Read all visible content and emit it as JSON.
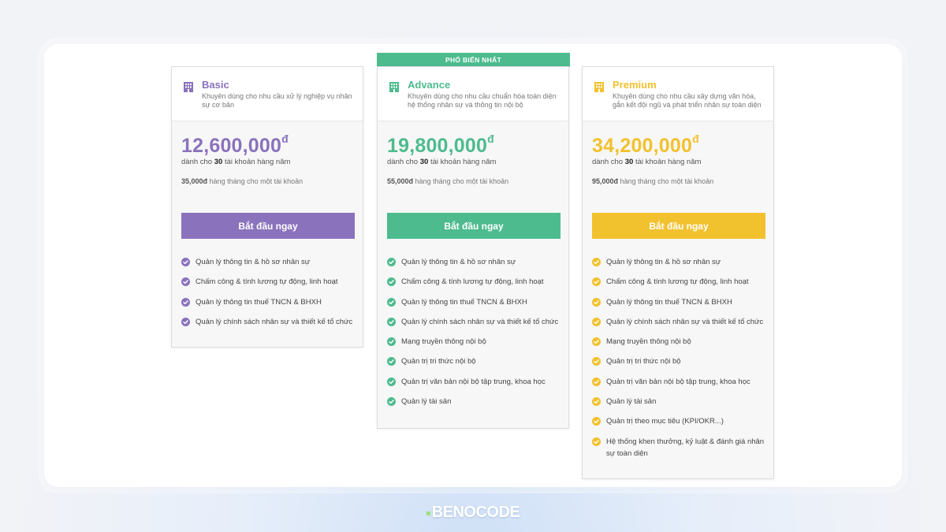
{
  "popular_badge": "PHỔ BIẾN NHẤT",
  "brand": "BENOCODE",
  "plans": [
    {
      "name": "Basic",
      "color": "#8a72bc",
      "icon": "building-icon",
      "description": "Khuyên dùng cho nhu cầu xử lý nghiệp vụ nhân sự cơ bản",
      "price": "12,600,000",
      "currency": "đ",
      "accounts_prefix": "dành cho",
      "accounts_count": "30",
      "accounts_suffix": "tài khoản hàng năm",
      "monthly_price": "35,000đ",
      "monthly_text": "hàng tháng cho một tài khoản",
      "cta": "Bắt đầu ngay",
      "features": [
        "Quản lý thông tin & hồ sơ nhân sự",
        "Chấm công & tính lương tự động, linh hoạt",
        "Quản lý thông tin thuế TNCN & BHXH",
        "Quản lý chính sách nhân sự và thiết kế tổ chức"
      ]
    },
    {
      "name": "Advance",
      "color": "#4dbb8e",
      "icon": "building-icon",
      "description": "Khuyên dùng cho nhu cầu chuẩn hóa toàn diện hệ thống nhân sự và thông tin nội bộ",
      "price": "19,800,000",
      "currency": "đ",
      "accounts_prefix": "dành cho",
      "accounts_count": "30",
      "accounts_suffix": "tài khoản hàng năm",
      "monthly_price": "55,000đ",
      "monthly_text": "hàng tháng cho một tài khoản",
      "cta": "Bắt đầu ngay",
      "features": [
        "Quản lý thông tin & hồ sơ nhân sự",
        "Chấm công & tính lương tự động, linh hoạt",
        "Quản lý thông tin thuế TNCN & BHXH",
        "Quản lý chính sách nhân sự và thiết kế tổ chức",
        "Mạng truyền thông nội bộ",
        "Quản trị tri thức nội bộ",
        "Quản trị văn bản nội bộ tập trung, khoa học",
        "Quản lý tài sản"
      ]
    },
    {
      "name": "Premium",
      "color": "#f2c12e",
      "icon": "building-icon",
      "description": "Khuyên dùng cho nhu cầu xây dựng văn hóa, gắn kết đội ngũ và phát triển nhân sự toàn diện",
      "price": "34,200,000",
      "currency": "đ",
      "accounts_prefix": "dành cho",
      "accounts_count": "30",
      "accounts_suffix": "tài khoản hàng năm",
      "monthly_price": "95,000đ",
      "monthly_text": "hàng tháng cho một tài khoản",
      "cta": "Bắt đầu ngay",
      "features": [
        "Quản lý thông tin & hồ sơ nhân sự",
        "Chấm công & tính lương tự động, linh hoạt",
        "Quản lý thông tin thuế TNCN & BHXH",
        "Quản lý chính sách nhân sự và thiết kế tổ chức",
        "Mạng truyền thông nội bộ",
        "Quản trị tri thức nội bộ",
        "Quản trị văn bản nội bộ tập trung, khoa học",
        "Quản lý tài sản",
        "Quản trị theo mục tiêu (KPI/OKR...)",
        "Hệ thống khen thưởng, kỷ luật & đánh giá nhân sự toàn diện"
      ]
    }
  ]
}
